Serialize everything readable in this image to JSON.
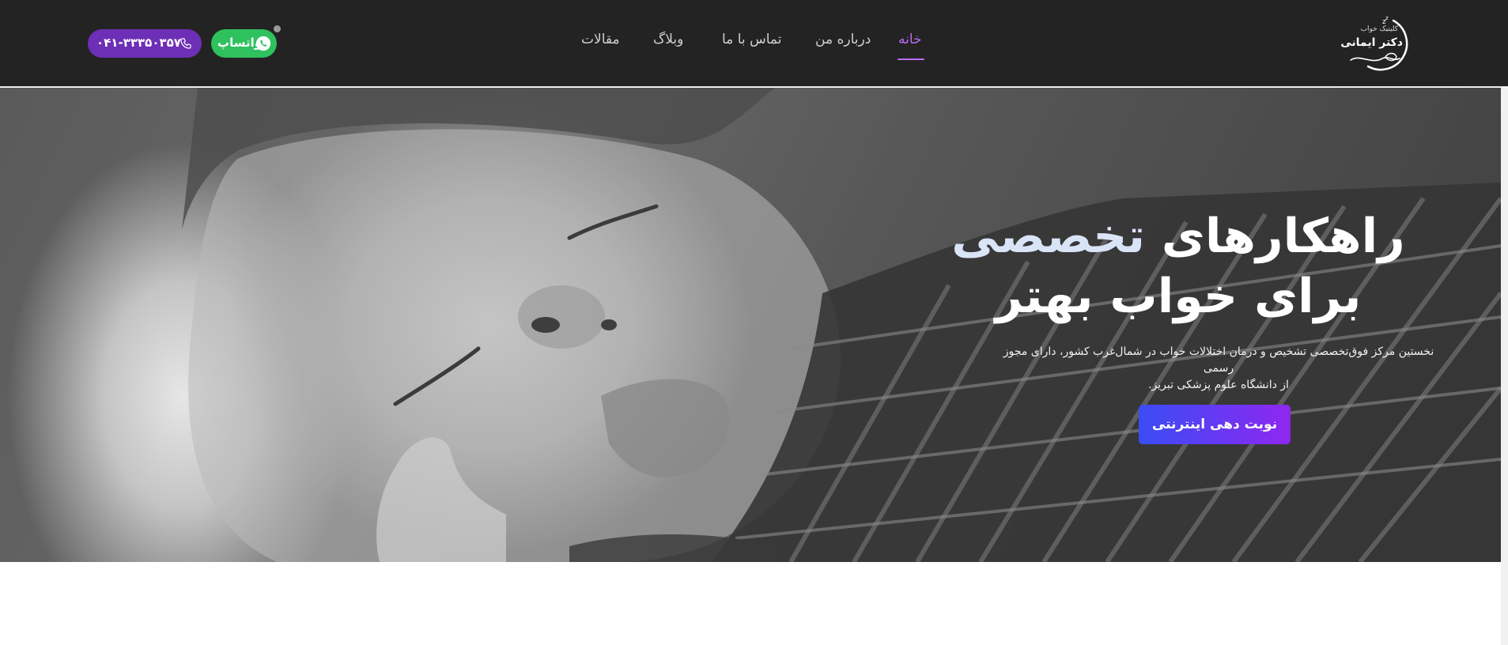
{
  "brand": {
    "title": "دکتر ایمانی",
    "subtitle": "کلینیک خواب"
  },
  "nav": {
    "items": [
      {
        "label": "خانه",
        "active": true
      },
      {
        "label": "درباره من",
        "active": false
      },
      {
        "label": "تماس با ما",
        "active": false
      },
      {
        "label": "وبلاگ",
        "active": false
      },
      {
        "label": "مقالات",
        "active": false
      }
    ]
  },
  "contact": {
    "whatsapp_label": "واتساپ",
    "phone_number": "۰۴۱-۳۳۳۵۰۳۵۷"
  },
  "hero": {
    "title_line1_accent": "تخصصی",
    "title_line1_rest": "راهکارهای",
    "title_line2": "برای خواب بهتر",
    "description_line1": "نخستین مرکز فوق‌تخصصی تشخیص و درمان اختلالات خواب در شمال‌غرب کشور، دارای مجوز رسمی",
    "description_line2": "از دانشگاه علوم پزشکی تبریز.",
    "cta_label": "نوبت دهی اینترنتی"
  },
  "colors": {
    "header_bg": "#232323",
    "accent_purple": "#b96af3",
    "phone_bg": "#6d2fb6",
    "whatsapp_bg": "#2ec15d",
    "cta_gradient_start": "#3a4df5",
    "cta_gradient_end": "#8f27f0"
  },
  "icons": {
    "logo": "moon-logo-icon",
    "phone": "phone-icon",
    "whatsapp": "whatsapp-icon"
  }
}
